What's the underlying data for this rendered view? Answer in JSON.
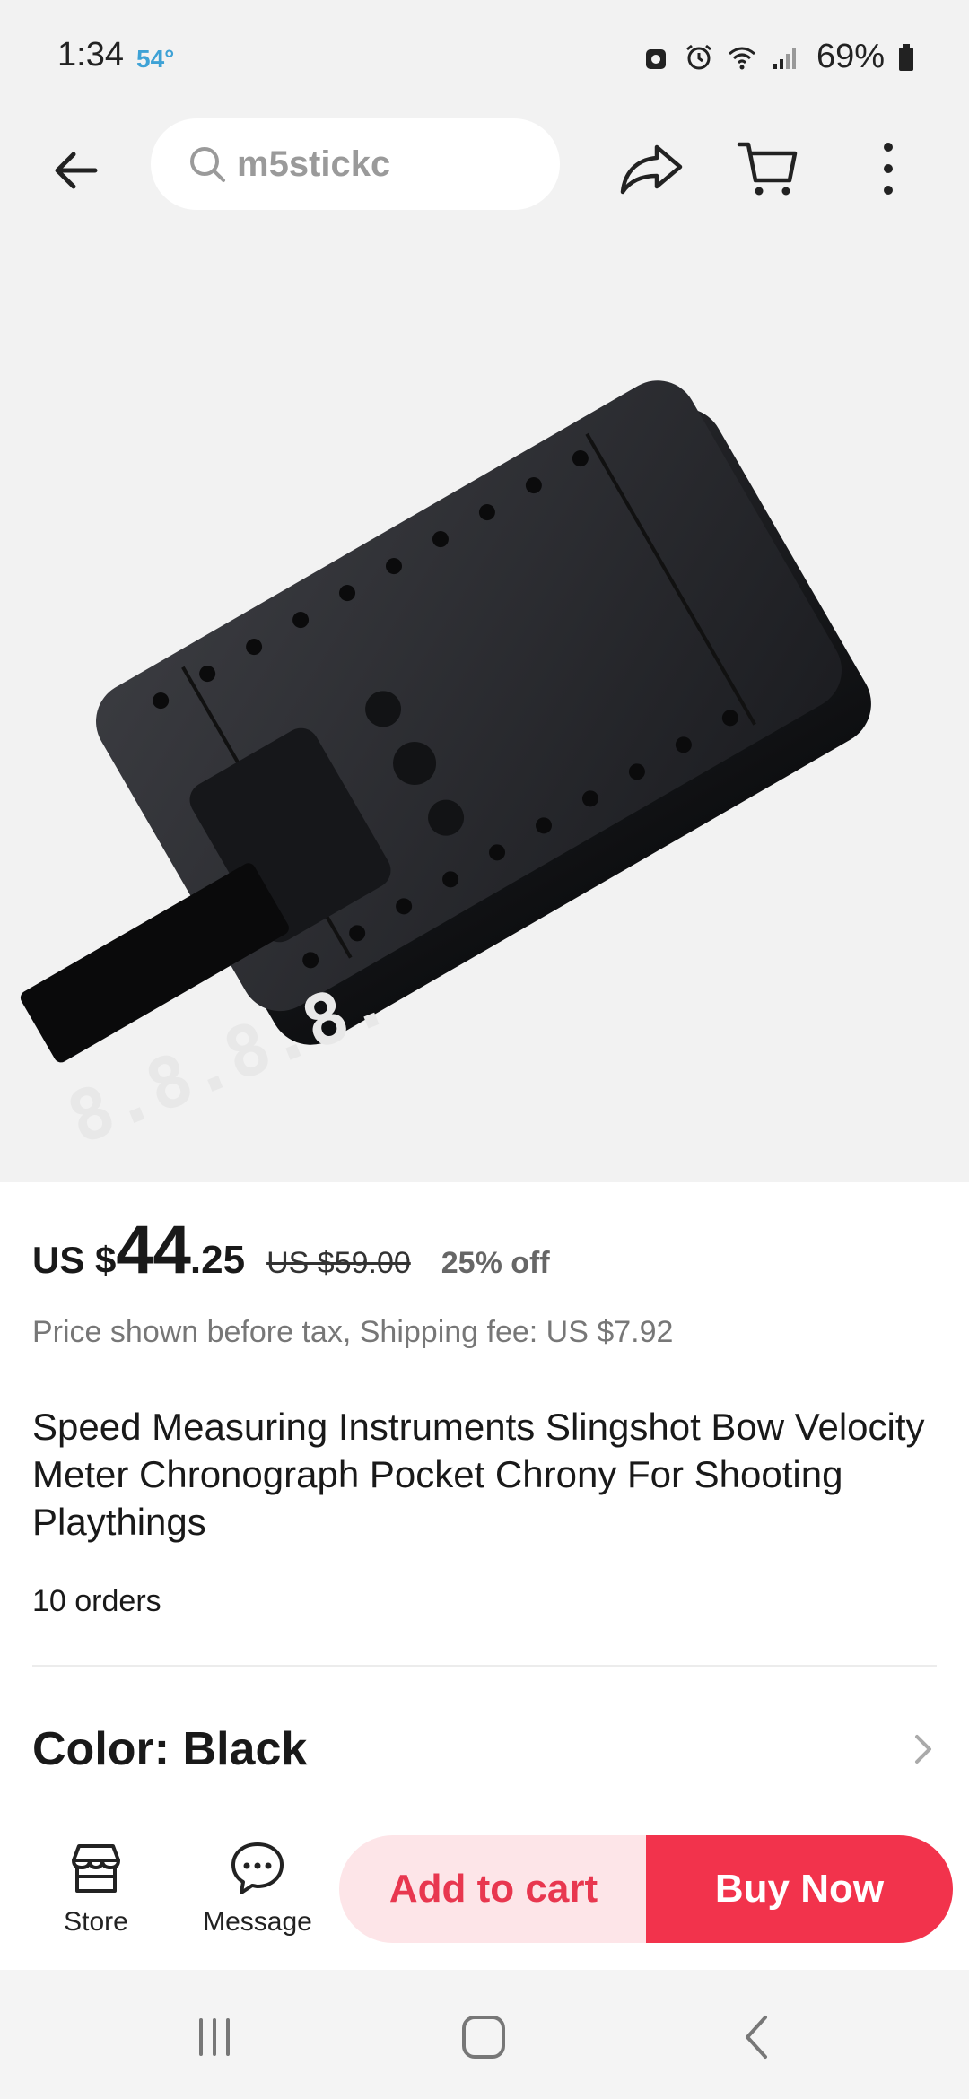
{
  "status_bar": {
    "time": "1:34",
    "temperature": "54°",
    "battery": "69%"
  },
  "search": {
    "query": "m5stickc"
  },
  "product": {
    "price_prefix": "US $",
    "price_integer": "44",
    "price_decimal": ".25",
    "original_price": "US $59.00",
    "discount": "25% off",
    "tax_note": "Price shown before tax, Shipping fee: US $7.92",
    "title": "Speed Measuring Instruments Slingshot Bow Velocity Meter Chronograph Pocket Chrony For Shooting Playthings",
    "orders": "10 orders",
    "color_label": "Color: Black",
    "display_digits": "8.8.8.8."
  },
  "actions": {
    "store_label": "Store",
    "message_label": "Message",
    "add_to_cart_label": "Add to cart",
    "buy_now_label": "Buy Now"
  },
  "colors": {
    "accent": "#f2334c",
    "accent_light": "#fde5e8",
    "background": "#f2f2f2"
  },
  "icons": {
    "back": "arrow-left-icon",
    "search": "search-icon",
    "share": "share-icon",
    "cart": "cart-icon",
    "more": "more-vertical-icon",
    "store": "store-icon",
    "message": "message-icon",
    "chevron": "chevron-right-icon"
  }
}
